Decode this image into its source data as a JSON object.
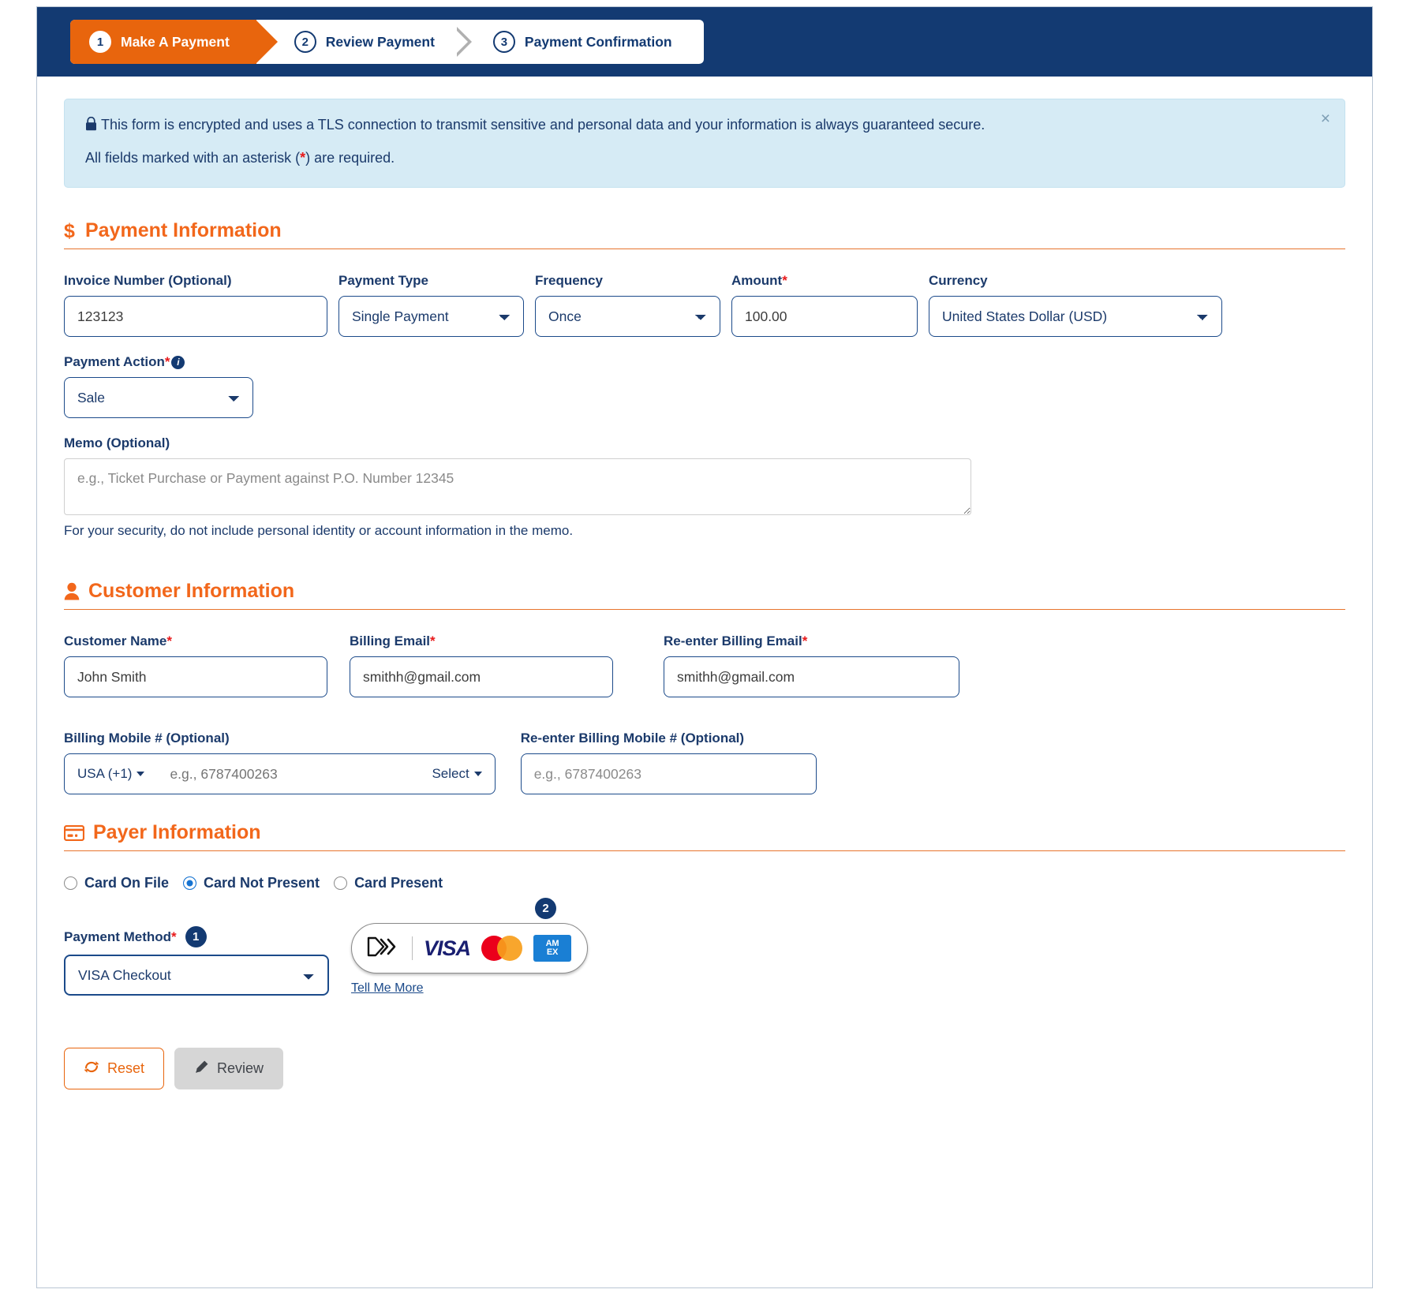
{
  "stepper": {
    "steps": [
      {
        "num": "1",
        "label": "Make A Payment",
        "active": true
      },
      {
        "num": "2",
        "label": "Review Payment",
        "active": false
      },
      {
        "num": "3",
        "label": "Payment Confirmation",
        "active": false
      }
    ]
  },
  "alert": {
    "line1": "This form is encrypted and uses a TLS connection to transmit sensitive and personal data and your information is always guaranteed secure.",
    "line2_pre": "All fields marked with an asterisk (",
    "line2_star": "*",
    "line2_post": ") are required.",
    "close_label": "×",
    "bg_color": "#d6ebf5"
  },
  "payment_information": {
    "title": "Payment Information",
    "icon": "dollar-icon",
    "invoice_number": {
      "label": "Invoice Number (Optional)",
      "value": "123123"
    },
    "payment_type": {
      "label": "Payment Type",
      "value": "Single Payment"
    },
    "frequency": {
      "label": "Frequency",
      "value": "Once"
    },
    "amount": {
      "label": "Amount",
      "required": "*",
      "value": "100.00"
    },
    "currency": {
      "label": "Currency",
      "value": "United States Dollar (USD)"
    },
    "payment_action": {
      "label": "Payment Action",
      "required": "*",
      "value": "Sale",
      "info": "i"
    },
    "memo": {
      "label": "Memo (Optional)",
      "value": "",
      "placeholder": "e.g., Ticket Purchase or Payment against P.O. Number 12345",
      "help": "For your security, do not include personal identity or account information in the memo."
    }
  },
  "customer_information": {
    "title": "Customer Information",
    "icon": "person-icon",
    "customer_name": {
      "label": "Customer Name",
      "required": "*",
      "value": "John Smith"
    },
    "billing_email": {
      "label": "Billing Email",
      "required": "*",
      "value": "smithh@gmail.com"
    },
    "reenter_billing_email": {
      "label": "Re-enter Billing Email",
      "required": "*",
      "value": "smithh@gmail.com"
    },
    "billing_mobile": {
      "label": "Billing Mobile # (Optional)",
      "country_code": "USA (+1)",
      "value": "",
      "placeholder": "e.g., 6787400263",
      "select_label": "Select"
    },
    "reenter_billing_mobile": {
      "label": "Re-enter Billing Mobile # (Optional)",
      "value": "",
      "placeholder": "e.g., 6787400263"
    }
  },
  "payer_information": {
    "title": "Payer Information",
    "icon": "credit-card-icon",
    "card_options": [
      {
        "label": "Card On File",
        "checked": false
      },
      {
        "label": "Card Not Present",
        "checked": true
      },
      {
        "label": "Card Present",
        "checked": false
      }
    ],
    "payment_method": {
      "label": "Payment Method",
      "required": "*",
      "value": "VISA Checkout",
      "marker": "1"
    },
    "card_logos": {
      "marker": "2",
      "visa_text": "VISA",
      "amex_line1": "AM",
      "amex_line2": "EX",
      "tell_me_more": "Tell Me More"
    }
  },
  "footer": {
    "reset_label": "Reset",
    "review_label": "Review"
  },
  "colors": {
    "brand_navy": "#133a72",
    "brand_orange": "#e8650d",
    "required_red": "#e8191b",
    "alert_blue": "#d6ebf5"
  }
}
